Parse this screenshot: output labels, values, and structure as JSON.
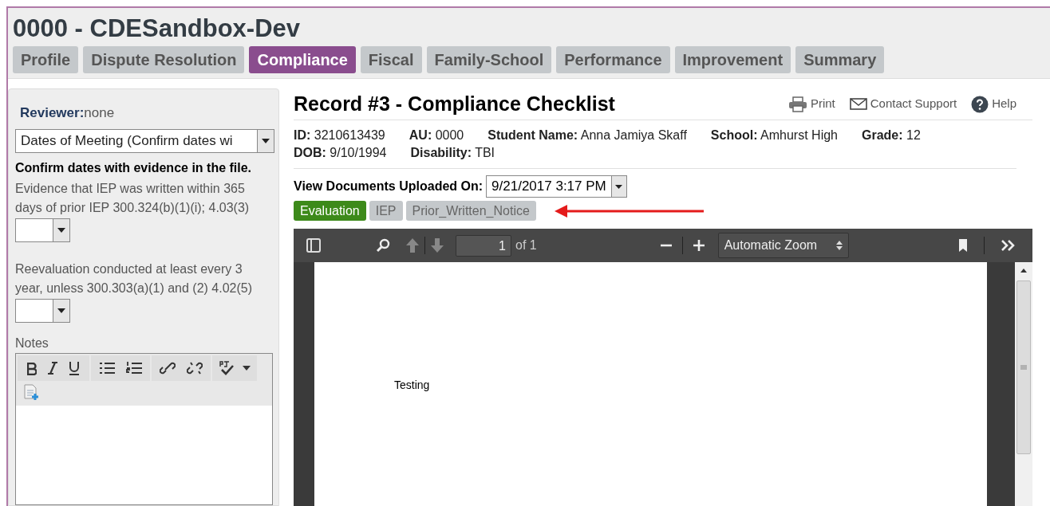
{
  "header": {
    "title": "0000 - CDESandbox-Dev"
  },
  "tabs": [
    {
      "label": "Profile",
      "selected": false
    },
    {
      "label": "Dispute Resolution",
      "selected": false
    },
    {
      "label": "Compliance",
      "selected": true
    },
    {
      "label": "Fiscal",
      "selected": false
    },
    {
      "label": "Family-School",
      "selected": false
    },
    {
      "label": "Performance",
      "selected": false
    },
    {
      "label": "Improvement",
      "selected": false
    },
    {
      "label": "Summary",
      "selected": false
    }
  ],
  "sidebar": {
    "reviewer_label": "Reviewer:",
    "reviewer_value": "none",
    "section_select": "Dates of Meeting (Confirm dates wi",
    "heading": "Confirm dates with evidence in the file.",
    "questions": [
      {
        "text": "Evidence that IEP was written within 365 days of prior IEP 300.324(b)(1)(i); 4.03(3)"
      },
      {
        "text": "Reevaluation conducted at least every 3 year, unless 300.303(a)(1) and (2) 4.02(5)"
      }
    ],
    "notes_label": "Notes"
  },
  "record": {
    "title": "Record #3 - Compliance Checklist",
    "actions": [
      {
        "kind": "print",
        "label": "Print"
      },
      {
        "kind": "mail",
        "label": "Contact Support"
      },
      {
        "kind": "help",
        "label": "Help"
      }
    ],
    "field_rows": [
      [
        {
          "label": "ID:",
          "value": "3210613439"
        },
        {
          "label": "AU:",
          "value": "0000"
        },
        {
          "label": "Student Name:",
          "value": "Anna Jamiya Skaff"
        },
        {
          "label": "School:",
          "value": "Amhurst High"
        },
        {
          "label": "Grade:",
          "value": "12"
        }
      ],
      [
        {
          "label": "DOB:",
          "value": "9/10/1994"
        },
        {
          "label": "Disability:",
          "value": "TBI"
        }
      ]
    ],
    "uploaded_label": "View Documents Uploaded On:",
    "uploaded_value": "9/21/2017 3:17 PM",
    "documents": [
      {
        "label": "Evaluation",
        "selected": true
      },
      {
        "label": "IEP",
        "selected": false
      },
      {
        "label": "Prior_Written_Notice",
        "selected": false
      }
    ]
  },
  "viewer": {
    "page": "1",
    "page_count": "of 1",
    "zoom": "Automatic Zoom",
    "document_text": "Testing"
  }
}
